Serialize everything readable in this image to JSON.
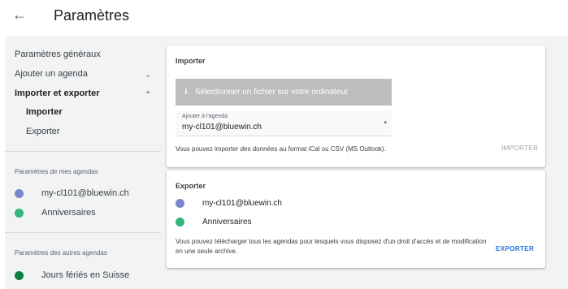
{
  "header": {
    "title": "Paramètres"
  },
  "sidebar": {
    "general": "Paramètres généraux",
    "add_calendar": "Ajouter un agenda",
    "import_export": "Importer et exporter",
    "import": "Importer",
    "export": "Exporter",
    "my_calendars_heading": "Paramètres de mes agendas",
    "my_calendars": [
      {
        "name": "my-cl101@bluewin.ch",
        "color": "#7986cb"
      },
      {
        "name": "Anniversaires",
        "color": "#33b679"
      }
    ],
    "other_calendars_heading": "Paramètres des autres agendas",
    "other_calendars": [
      {
        "name": "Jours fériés en Suisse",
        "color": "#0b8043"
      }
    ]
  },
  "import_card": {
    "title": "Importer",
    "file_button": "Sélectionner un fichier sur votre ordinateur",
    "select_label": "Ajouter à l'agenda",
    "select_value": "my-cl101@bluewin.ch",
    "note": "Vous pouvez importer des données au format iCal ou CSV (MS Outlook).",
    "action": "IMPORTER"
  },
  "export_card": {
    "title": "Exporter",
    "calendars": [
      {
        "name": "my-cl101@bluewin.ch",
        "color": "#7986cb"
      },
      {
        "name": "Anniversaires",
        "color": "#33b679"
      }
    ],
    "note": "Vous pouvez télécharger tous les agendas pour lesquels vous disposez d'un droit d'accès et de modification en une seule archive.",
    "action": "EXPORTER"
  },
  "colors": {
    "accent": "#1a73e8",
    "disabled": "#9aa0a6"
  }
}
